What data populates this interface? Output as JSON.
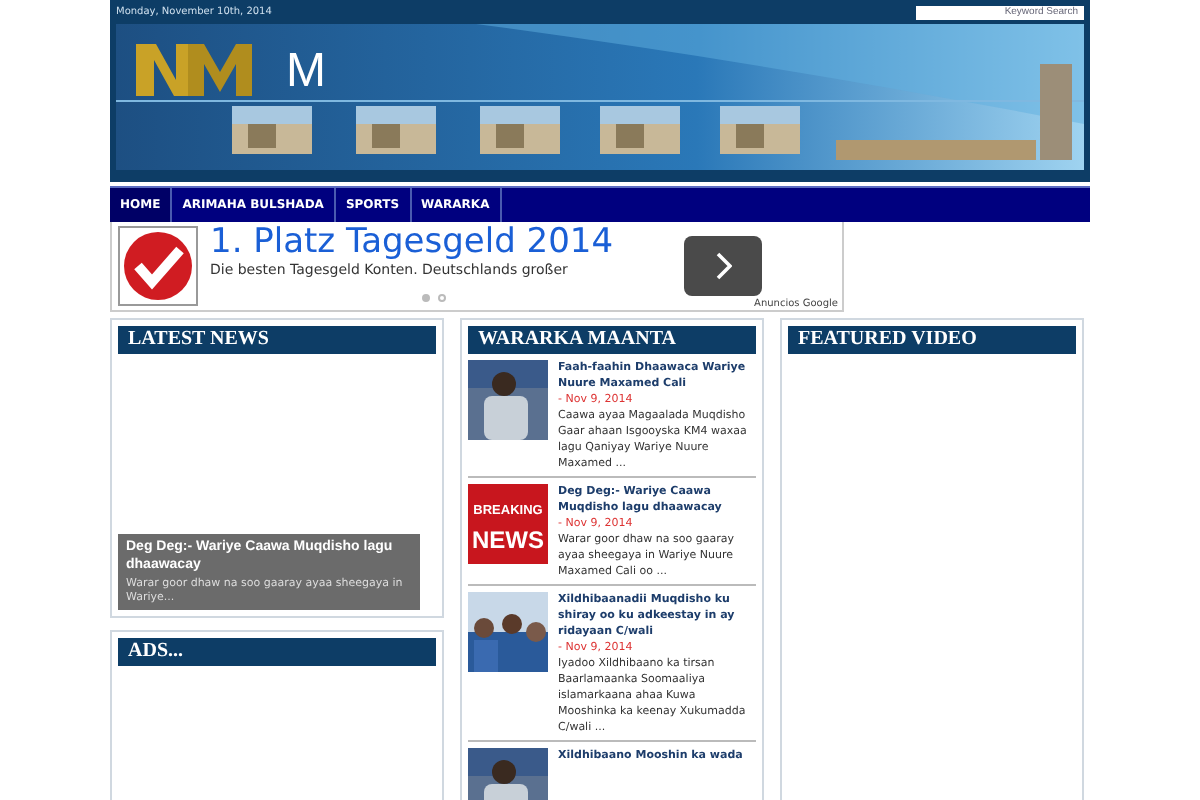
{
  "top_bar": {
    "date": "Monday, November 10th, 2014",
    "search": {
      "placeholder": "Keyword Search"
    }
  },
  "banner": {
    "title": "M"
  },
  "nav": [
    {
      "label": "HOME",
      "selected": true
    },
    {
      "label": "ARIMAHA BULSHADA",
      "selected": false
    },
    {
      "label": "SPORTS",
      "selected": false
    },
    {
      "label": "WARARKA",
      "selected": false
    }
  ],
  "ad": {
    "headline": "1. Platz Tagesgeld 2014",
    "text": "Die besten Tagesgeld Konten. Deutschlands großer",
    "attribution": "Anuncios Google",
    "dots": [
      {
        "selected": true
      },
      {
        "selected": false
      }
    ]
  },
  "latest_news": {
    "heading": "LATEST NEWS",
    "caption_title": "Deg Deg:- Wariye Caawa Muqdisho lagu dhaawacay",
    "caption_text": "Warar goor dhaw na soo gaaray ayaa sheegaya in Wariye..."
  },
  "ads": {
    "heading": "ADS..."
  },
  "wararka": {
    "heading": "WARARKA MAANTA",
    "items": [
      {
        "title": "Faah-faahin Dhaawaca Wariye Nuure Maxamed Cali",
        "date": "- Nov 9, 2014",
        "excerpt": "Caawa ayaa Magaalada Muqdisho Gaar ahaan Isgooyska KM4 waxaa lagu Qaniyay Wariye Nuure Maxamed ...",
        "kind": "person"
      },
      {
        "title": "Deg Deg:- Wariye Caawa Muqdisho lagu dhaawacay",
        "date": "- Nov 9, 2014",
        "excerpt": "Warar goor dhaw na soo gaaray ayaa sheegaya in Wariye Nuure Maxamed Cali oo ...",
        "kind": "breaking",
        "thumb_lines": [
          "BREAKING",
          "NEWS"
        ]
      },
      {
        "title": "Xildhibaanadii Muqdisho ku shiray oo ku adkeestay in ay ridayaan C/wali",
        "date": "- Nov 9, 2014",
        "excerpt": "Iyadoo Xildhibaano ka tirsan Baarlamaanka Soomaaliya islamarkaana ahaa Kuwa Mooshinka ka keenay Xukumadda C/wali ...",
        "kind": "crowd"
      },
      {
        "title": "Xildhibaano Mooshin ka wada",
        "kind": "person"
      }
    ]
  },
  "featured_video": {
    "heading": "FEATURED VIDEO"
  }
}
